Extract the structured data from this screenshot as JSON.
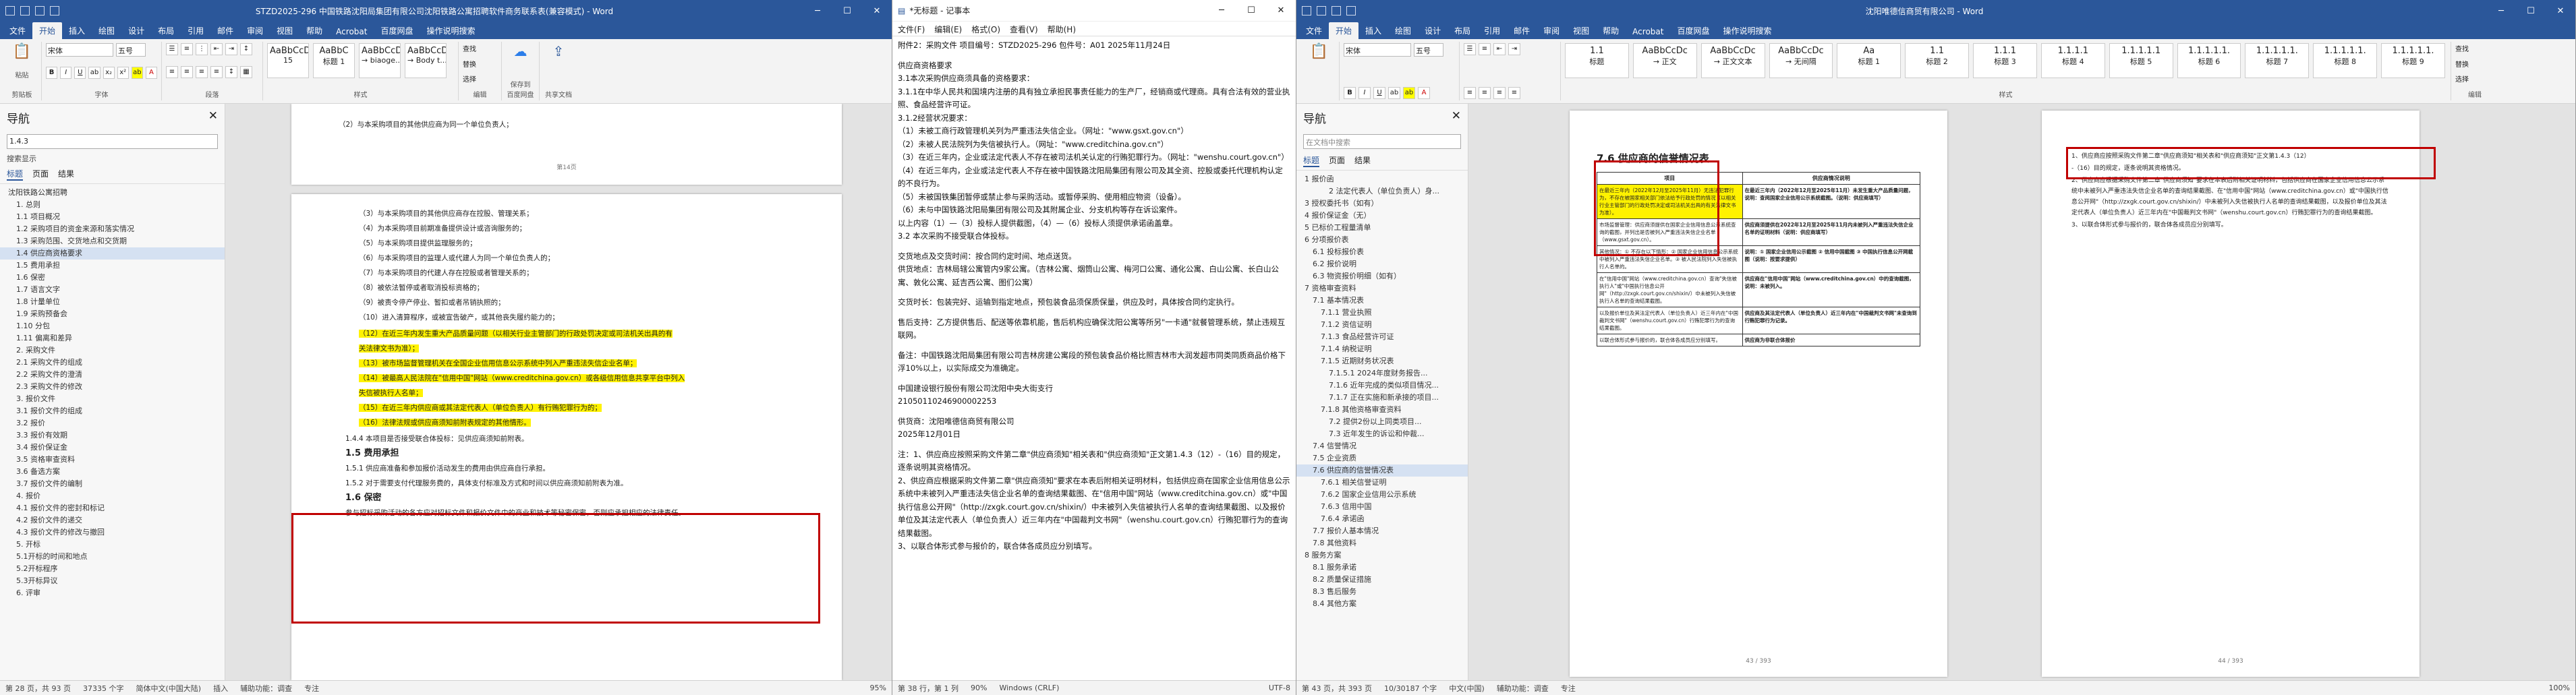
{
  "w1": {
    "title": "STZD2025-296 中国铁路沈阳局集团有限公司沈阳铁路公寓招聘软件商务联系表(兼容模式) - Word",
    "tabs": [
      "文件",
      "开始",
      "插入",
      "绘图",
      "设计",
      "布局",
      "引用",
      "邮件",
      "审阅",
      "视图",
      "帮助",
      "Acrobat",
      "百度网盘",
      "操作说明搜索"
    ],
    "ribbon": {
      "clipboard": "剪贴板",
      "paste": "粘贴",
      "font_name": "宋体",
      "font_size": "五号",
      "font": "字体",
      "paragraph": "段落",
      "styles": [
        "AaBbCcDc",
        "AaBbC",
        "AaBbCcDd",
        "AaBbCcDc"
      ],
      "style_names": [
        "15",
        "标题 1",
        "→ biaoge...",
        "→ Body t..."
      ],
      "styles_label": "样式",
      "find": "查找",
      "replace": "替换",
      "select": "选择",
      "editing": "编辑",
      "save": "保存到\n百度网盘",
      "cloud": "共享文档"
    },
    "nav": {
      "title": "导航",
      "search": "1.4.3",
      "sub": "搜索显示",
      "tabs": [
        "标题",
        "页面",
        "结果"
      ],
      "items": [
        "沈阳铁路公寓招聘",
        "1. 总则",
        "1.1 项目概况",
        "1.2 采购项目的资金来源和落实情况",
        "1.3 采购范围、交货地点和交货期",
        "1.4 供应商资格要求",
        "1.5 费用承担",
        "1.6 保密",
        "1.7 语言文字",
        "1.8 计量单位",
        "1.9 采购预备会",
        "1.10 分包",
        "1.11 偏离和差异",
        "2. 采购文件",
        "2.1 采购文件的组成",
        "2.2 采购文件的澄清",
        "2.3 采购文件的修改",
        "3. 报价文件",
        "3.1 报价文件的组成",
        "3.2 报价",
        "3.3 报价有效期",
        "3.4 报价保证金",
        "3.5 资格审查资料",
        "3.6 备选方案",
        "3.7 报价文件的编制",
        "4. 报价",
        "4.1 报价文件的密封和标记",
        "4.2 报价文件的递交",
        "4.3 报价文件的修改与撤回",
        "5. 开标",
        "5.1开标的时间和地点",
        "5.2开标程序",
        "5.3开标异议",
        "6. 评审"
      ],
      "selected": 5
    },
    "doc": {
      "page_label": "第14页",
      "lines_top": [
        "（2）与本采购项目的其他供应商为同一个单位负责人；"
      ],
      "lines": [
        "（3）与本采购项目的其他供应商存在控股、管理关系；",
        "（4）为本采购项目前期准备提供设计或咨询服务的；",
        "（5）与本采购项目提供监理服务的；",
        "（6）与本采购项目的监理人或代建人为同一个单位负责人的；",
        "（7）与本采购项目的代建人存在控股或者管理关系的；",
        "（8）被依法暂停或者取消投标资格的；",
        "（9）被责令停产停业、暂扣或者吊销执照的；",
        "（10）进入清算程序，或被宣告破产，或其他丧失履约能力的；"
      ],
      "hl_lines": [
        "（12）在近三年内发生重大产品质量问题（以相关行业主管部门的行政处罚决定或司法机关出具的有",
        "关法律文书为准）；",
        "（13）被市场监督管理机关在全国企业信用信息公示系统中列入严重违法失信企业名单；",
        "（14）被最高人民法院在\"信用中国\"网站（www.creditchina.gov.cn）或各级信用信息共享平台中列入",
        "失信被执行人名单；",
        "（15）在近三年内供应商或其法定代表人（单位负责人）有行贿犯罪行为的；",
        "（16）法律法规或供应商须知前附表规定的其他情形。"
      ],
      "after": [
        "1.4.4 本项目是否接受联合体投标：见供应商须知前附表。",
        "1.5 费用承担",
        "1.5.1 供应商准备和参加报价活动发生的费用由供应商自行承担。",
        "1.5.2 对于需要支付代理服务费的，具体支付标准及方式和时间以供应商须知前附表为准。",
        "1.6 保密",
        "参与招标采购活动的各方应对招标文件和报价文件中的商业和技术等秘密保密，否则应承担相应的法律责任。"
      ]
    },
    "status": [
      "第 28 页，共 93 页",
      "37335 个字",
      "简体中文(中国大陆)",
      "插入",
      "辅助功能：调查",
      "专注",
      "95%"
    ]
  },
  "w2": {
    "title": "*无标题 - 记事本",
    "menu": [
      "文件(F)",
      "编辑(E)",
      "格式(O)",
      "查看(V)",
      "帮助(H)"
    ],
    "paras": [
      "附件2：采购文件        项目编号：STZD2025-296 包件号：A01   2025年11月24日",
      "",
      "供应商资格要求",
      "3.1本次采购供应商须具备的资格要求：",
      "3.1.1在中华人民共和国境内注册的具有独立承担民事责任能力的生产厂，经销商或代理商。具有合法有效的营业执照、食品经营许可证。",
      "3.1.2经营状况要求：",
      "（1）未被工商行政管理机关列为严重违法失信企业。（网址：\"www.gsxt.gov.cn\"）",
      "（2）未被人民法院列为失信被执行人。（网址：\"www.creditchina.gov.cn\"）",
      "（3）在近三年内，企业或法定代表人不存在被司法机关认定的行贿犯罪行为。（网址：\"wenshu.court.gov.cn\"）",
      "（4）在近三年内，企业或法定代表人不存在被中国铁路沈阳局集团有限公司及其全资、控股或委托代理机构认定的不良行为。",
      "（5）未被国铁集团暂停或禁止参与采购活动。或暂停采购、使用相应物资（设备）。",
      "（6）未与中国铁路沈阳局集团有限公司及其附属企业、分支机构等存在诉讼案件。",
      "以上内容（1）—（3）投标人提供截图，（4）—（6）投标人须提供承诺函盖章。",
      "3.2 本次采购不接受联合体投标。",
      "",
      "交货地点及交货时间：按合同约定时间、地点送货。",
      "供货地点：吉林局辖公寓管内9家公寓。（吉林公寓、烟筒山公寓、梅河口公寓、通化公寓、白山公寓、长白山公寓、敦化公寓、延吉西公寓、图们公寓）",
      "",
      "交货时长：包装完好、运输到指定地点，预包装食品须保质保量，供应及时，具体按合同约定执行。",
      "",
      "售后支持：乙方提供售后、配送等依靠机能，售后机构应确保沈阳公寓等所另\"一卡通\"就餐管理系统，禁止违规互联网。",
      "",
      "备注：中国铁路沈阳局集团有限公司吉林房建公寓段的预包装食品价格比照吉林市大润发超市同类同质商品价格下浮10%以上，以实际成交为准确定。",
      "",
      "中国建设银行股份有限公司沈阳中央大街支行",
      "21050110246900002253",
      "",
      "供货商：沈阳唯德信商贸有限公司",
      "2025年12月01日",
      "",
      "注：1、供应商应按照采购文件第二章\"供应商须知\"相关表和\"供应商须知\"正文第1.4.3（12）-（16）目的规定，逐条说明其资格情况。",
      "2、供应商应根据采购文件第二章\"供应商须知\"要求在本表后附相关证明材料，包括供应商在国家企业信用信息公示系统中未被列入严重违法失信企业名单的查询结果截图、在\"信用中国\"网站（www.creditchina.gov.cn）或\"中国执行信息公开网\"（http://zxgk.court.gov.cn/shixin/）中未被列入失信被执行人名单的查询结果截图、以及报价单位及其法定代表人（单位负责人）近三年内在\"中国裁判文书网\"（wenshu.court.gov.cn）行贿犯罪行为的查询结果截图。",
      "3、以联合体形式参与报价的，联合体各成员应分别填写。"
    ],
    "status": [
      "第 38 行，第 1 列",
      "90%",
      "Windows (CRLF)",
      "UTF-8"
    ]
  },
  "w3": {
    "title": "沈阳唯德信商贸有限公司 - Word",
    "tabs": [
      "文件",
      "开始",
      "插入",
      "绘图",
      "设计",
      "布局",
      "引用",
      "邮件",
      "审阅",
      "视图",
      "帮助",
      "Acrobat",
      "百度网盘",
      "操作说明搜索"
    ],
    "ribbon": {
      "font_name": "宋体",
      "font_size": "五号",
      "styles": [
        "1.1",
        "AaBbCcDc",
        "AaBbCcDc",
        "AaBbCcDc",
        "Aa",
        "1.1",
        "1.1.1",
        "1.1.1.1",
        "1.1.1.1.1",
        "1.1.1.1.1.",
        "1.1.1.1.1.",
        "1.1.1.1.1.",
        "1.1.1.1.1."
      ],
      "style_names": [
        "标题",
        "→ 正文",
        "→ 正文文本",
        "→ 无间隔",
        "标题 1",
        "标题 2",
        "标题 3",
        "标题 4",
        "标题 5",
        "标题 6",
        "标题 7",
        "标题 8",
        "标题 9"
      ],
      "styles_label": "样式",
      "find": "查找",
      "replace": "替换",
      "select": "选择",
      "editing": "编辑"
    },
    "nav": {
      "title": "导航",
      "search": "在文档中搜索",
      "tabs": [
        "标题",
        "页面",
        "结果"
      ],
      "items": [
        "1 报价函",
        "2 法定代表人（单位负责人）身...",
        "3 授权委托书（如有）",
        "4 报价保证金（无）",
        "5 已标价工程量清单",
        "6 分项报价表",
        "6.1 投标报价表",
        "6.2 报价说明",
        "6.3 物资报价明细（如有）",
        "7 资格审查资料",
        "7.1 基本情况表",
        "7.1.1 营业执照",
        "7.1.2 资信证明",
        "7.1.3 食品经营许可证",
        "7.1.4 纳税证明",
        "7.1.5 近期财务状况表",
        "7.1.5.1 2024年度财务报告...",
        "7.1.6 近年完成的类似项目情况...",
        "7.1.7 正在实施和新承接的项目...",
        "7.1.8 其他资格审查资料",
        "7.2 提供2份以上同类项目...",
        "7.3 近年发生的诉讼和仲裁...",
        "7.4 信誉情况",
        "7.5 企业资质",
        "7.6 供应商的信誉情况表",
        "7.6.1 相关信誉证明",
        "7.6.2 国家企业信用公示系统",
        "7.6.3 信用中国",
        "7.6.4 承诺函",
        "7.7 报价人基本情况",
        "7.8 其他资料",
        "8 服务方案",
        "8.1 服务承诺",
        "8.2 质量保证措施",
        "8.3 售后服务",
        "8.4 其他方案"
      ],
      "selected": 24
    },
    "page1": {
      "heading": "7.6 供应商的信誉情况表",
      "th": [
        "项目",
        "供应商情况说明"
      ],
      "rows": [
        [
          "在最近三年内（2022年12月至2025年11月）无违法犯罪行为，不存在被国家相关部门依法给予行政处罚的情况（以相关行业主管部门的行政处罚决定或司法机关出具的有关法律文书为准）。",
          "在最近三年内（2022年12月至2025年11月）未发生重大产品质量问题，说明：查阅国家企业信用公示系统截图。（说明：供应商填写）"
        ],
        [
          "市场监督管理：供应商须提供在国家企业信用信息公示系统查询的截图，并列出是否被列入严重违法失信企业名单（www.gsxt.gov.cn）。",
          "供应商须提供在2022年12月至2025年11月内未被列入严重违法失信企业名单的证明材料（说明：供应商填写）"
        ],
        [
          "其他情况：① 不存在以下情形：② 国家企业信用信息公示系统中被列入严重违法失信企业名单。③ 被人民法院列入失信被执行人名单的。",
          "说明：① 国家企业信用公示截图 ② 信用中国截图 ③ 中国执行信息公开网截图（说明：按要求提供）"
        ],
        [
          "在\"信用中国\"网站（www.creditchina.gov.cn）查询\"失信被执行人\"或\"中国执行信息公开网\"（http://zxgk.court.gov.cn/shixin/）中未被列入失信被执行人名单的查询结果截图。",
          "供应商在\"信用中国\"网站（www.creditchina.gov.cn）中的查询截图，说明：未被列入。"
        ],
        [
          "以及报价单位及其法定代表人（单位负责人）近三年内在\"中国裁判文书网\"（wenshu.court.gov.cn）行贿犯罪行为的查询结果截图。",
          "供应商及其法定代表人（单位负责人）近三年内在\"中国裁判文书网\"未查询到行贿犯罪行为记录。"
        ],
        [
          "以联合体形式参与报价的，联合体各成员应分别填写。",
          "供应商为非联合体报价"
        ]
      ],
      "page_num": "43 / 393"
    },
    "page2": {
      "lines": [
        "1、供应商应按照采购文件第二章\"供应商须知\"相关表和\"供应商须知\"正文第1.4.3（12）",
        "-（16）目的规定，逐条说明其资格情况。",
        "2、供应商应根据采购文件第二章\"供应商须知\"要求在本表后附相关证明材料，包括供应商在国家企业信用信息公示系统中未被列入严重违法失信企业名单的查询结果截图、在\"信用中国\"网站（www.creditchina.gov.cn）或\"中国执行信息公开网\"（http://zxgk.court.gov.cn/shixin/）中未被列入失信被执行人名单的查询结果截图，以及报价单位及其法定代表人（单位负责人）近三年内在\"中国裁判文书网\"（wenshu.court.gov.cn）行贿犯罪行为的查询结果截图。",
        "3、以联合体形式参与报价的，联合体各成员应分别填写。"
      ],
      "page_num": "44 / 393"
    },
    "status": [
      "第 43 页，共 393 页",
      "10/30187 个字",
      "中文(中国)",
      "辅助功能：调查",
      "专注",
      "100%"
    ]
  }
}
